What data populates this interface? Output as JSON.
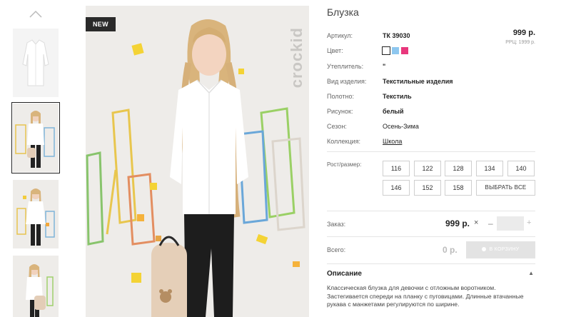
{
  "product": {
    "title": "Блузка",
    "badge": "NEW",
    "brand_mark": "crockid",
    "price": "999 р.",
    "rrp": "РРЦ: 1999 р."
  },
  "attributes": [
    {
      "label": "Артикул:",
      "value": "ТК 39030"
    },
    {
      "label": "Цвет:",
      "value": ""
    },
    {
      "label": "Утеплитель:",
      "value": "\""
    },
    {
      "label": "Вид изделия:",
      "value": "Текстильные изделия"
    },
    {
      "label": "Полотно:",
      "value": "Текстиль"
    },
    {
      "label": "Рисунок:",
      "value": "белый"
    },
    {
      "label": "Сезон:",
      "value": "Осень-Зима"
    },
    {
      "label": "Коллекция:",
      "value": "Школа"
    }
  ],
  "colors": [
    {
      "name": "white",
      "hex": "#ffffff",
      "selected": true
    },
    {
      "name": "light-blue",
      "hex": "#8ec7ef",
      "selected": false
    },
    {
      "name": "pink",
      "hex": "#e8377c",
      "selected": false
    }
  ],
  "sizes": {
    "label": "Рост/размер:",
    "options": [
      "116",
      "122",
      "128",
      "134",
      "140",
      "146",
      "152",
      "158"
    ],
    "select_all": "ВЫБРАТЬ ВСЕ"
  },
  "order": {
    "label": "Заказ:",
    "price": "999 р.",
    "multiply": "×",
    "minus": "–",
    "plus": "+",
    "quantity": ""
  },
  "total": {
    "label": "Всего:",
    "value": "0 р.",
    "cart_button": "В КОРЗИНУ"
  },
  "description": {
    "title": "Описание",
    "caret": "▲",
    "text": "Классическая блузка для девочки с отложным воротником. Застегивается спереди на планку с пуговицами. Длинные втачанные рукава с манжетами регулируются по ширине."
  },
  "icons": {
    "thumbs_up": "chevron-up-icon",
    "cart": "cart-dot-icon"
  },
  "palette": {
    "accent_dark": "#2a2a2a",
    "disabled": "#e3e3e3"
  }
}
